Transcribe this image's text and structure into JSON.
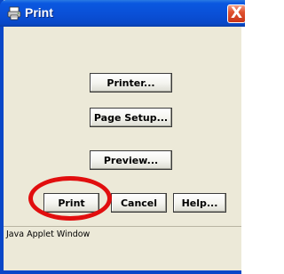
{
  "window": {
    "title": "Print",
    "close_glyph": "X"
  },
  "buttons": {
    "printer": "Printer...",
    "page_setup": "Page Setup...",
    "preview": "Preview...",
    "print": "Print",
    "cancel": "Cancel",
    "help": "Help..."
  },
  "status_bar": {
    "text": "Java Applet Window"
  },
  "colors": {
    "titlebar": "#0a4fd6",
    "frame": "#0a47c8",
    "dialog_bg": "#ece9d8",
    "close_button": "#e0522f",
    "highlight": "#e10e0e"
  },
  "icons": {
    "title_icon": "printer-icon",
    "close_icon": "close-icon"
  }
}
